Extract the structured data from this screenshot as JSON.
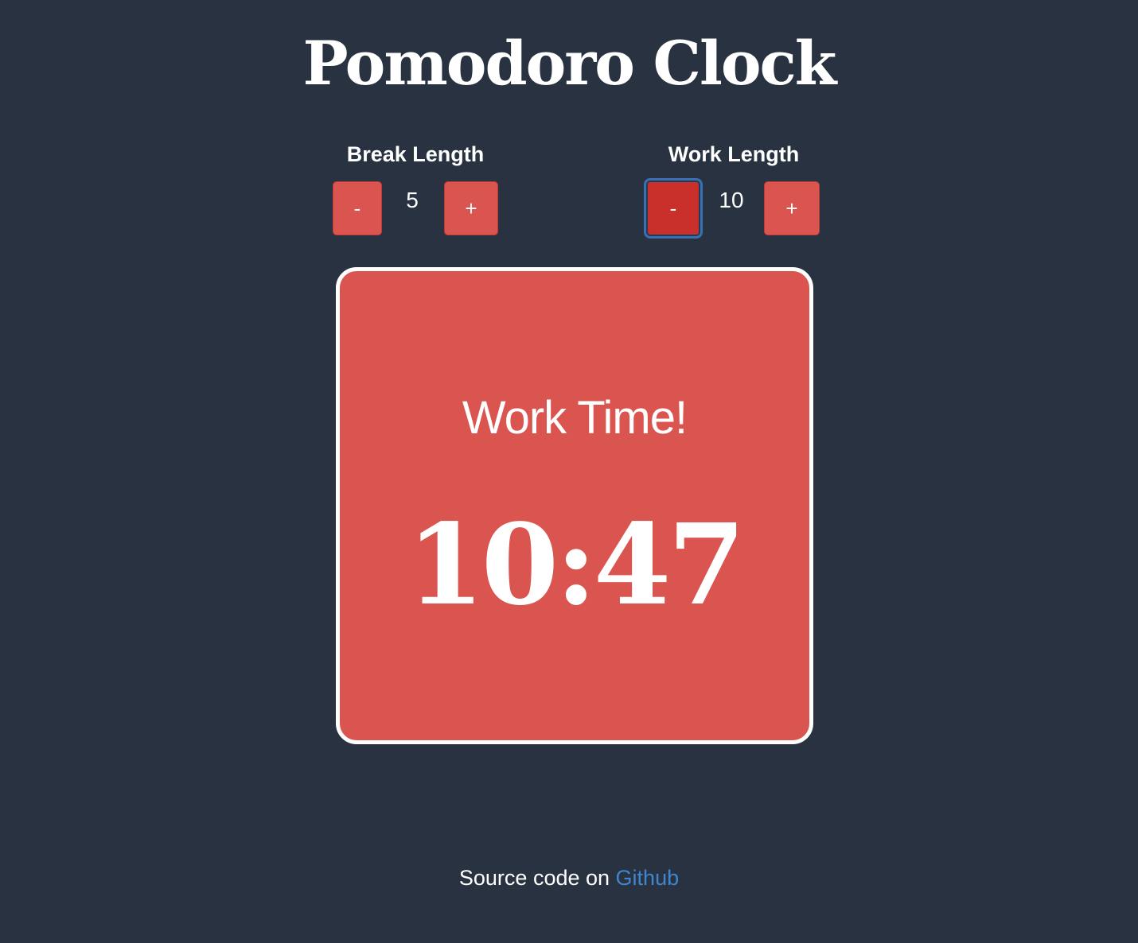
{
  "header": {
    "title": "Pomodoro Clock"
  },
  "break_control": {
    "label": "Break Length",
    "value": "5",
    "decrement_label": "-",
    "increment_label": "+"
  },
  "work_control": {
    "label": "Work Length",
    "value": "10",
    "decrement_label": "-",
    "increment_label": "+"
  },
  "clock": {
    "mode": "Work Time!",
    "time": "10:47"
  },
  "footer": {
    "text": "Source code on",
    "link_text": "Github"
  },
  "colors": {
    "background": "#293241",
    "accent": "#db5550",
    "link": "#3f86cf",
    "focus_ring": "#3a6fb0"
  }
}
